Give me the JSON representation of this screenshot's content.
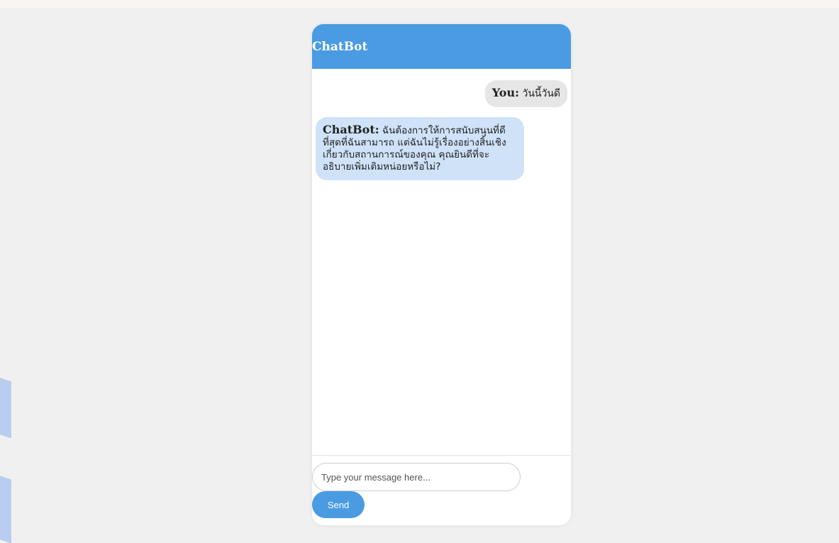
{
  "chat": {
    "title": "ChatBot",
    "messages": [
      {
        "sender": "You:",
        "text": "วันนี้วันดี"
      },
      {
        "sender": "ChatBot:",
        "text": "ฉันต้องการให้การสนับสนุนที่ดีที่สุดที่ฉันสามารถ แต่ฉันไม่รู้เรื่องอย่างสิ้นเชิงเกี่ยวกับสถานการณ์ของคุณ คุณยินดีที่จะอธิบายเพิ่มเติมหน่อยหรือไม่?"
      }
    ],
    "input": {
      "placeholder": "Type your message here..."
    },
    "send_label": "Send"
  },
  "colors": {
    "header": "#4a9be2",
    "bot_bubble": "#cfe2f8",
    "user_bubble": "#e6e6e6",
    "background": "#f0f0f0",
    "send_button": "#4a9be2"
  }
}
